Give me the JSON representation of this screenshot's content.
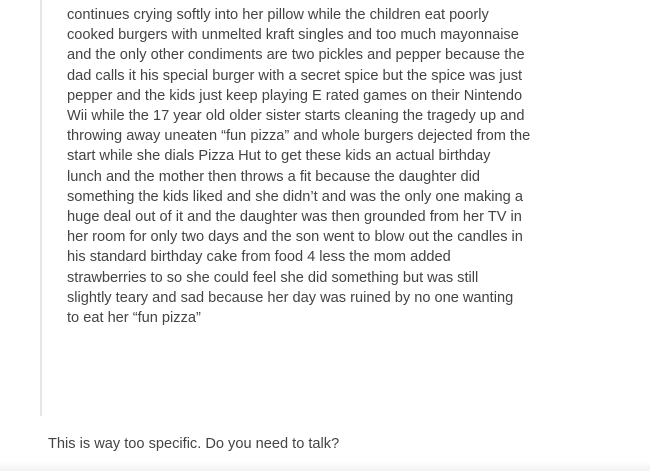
{
  "post": {
    "quoted_lines": [
      "continues crying softly into her pillow while the children eat poorly",
      "cooked burgers with unmelted kraft singles and too much mayonnaise",
      "and the only other condiments are two pickles and pepper because the",
      "dad calls it his special burger with a secret spice but the spice was just",
      "pepper and the kids just keep playing E rated games on their Nintendo",
      "Wii while the 17 year old older sister starts cleaning the tragedy up and",
      "throwing away uneaten “fun pizza” and whole burgers dejected from the",
      "start while she dials Pizza Hut to get these kids an actual birthday",
      "lunch and the mother then throws a fit because the daughter did",
      "something the kids liked and she didn’t and was the only one making a",
      "huge deal out of it and the daughter was then grounded from her TV in",
      "her room for only two days and the son went to blow out the candles in",
      "his standard birthday cake from food 4 less the mom added",
      "strawberries to so she could feel she did something but was still",
      "slightly teary and sad because her day was ruined by no one wanting",
      "to eat her “fun pizza”"
    ],
    "reply": "This is way too specific. Do you need to talk?"
  }
}
